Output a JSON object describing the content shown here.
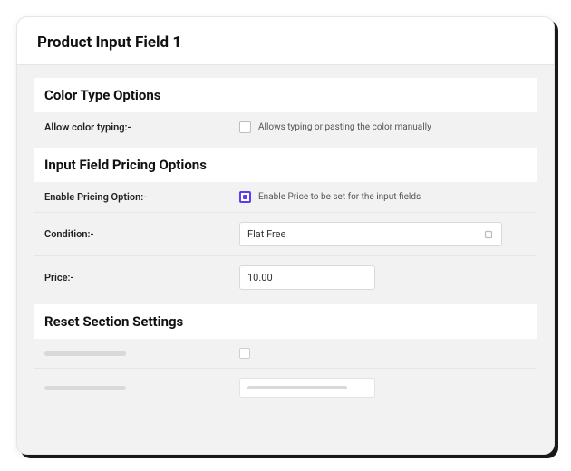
{
  "page": {
    "title": "Product Input Field 1"
  },
  "color_section": {
    "title": "Color Type Options",
    "allow_typing_label": "Allow color typing:-",
    "allow_typing_checked": false,
    "allow_typing_desc": "Allows typing or pasting the color manually"
  },
  "pricing_section": {
    "title": "Input Field Pricing Options",
    "enable_label": "Enable Pricing Option:-",
    "enable_checked": true,
    "enable_desc": "Enable Price to be set for the input fields",
    "condition_label": "Condition:-",
    "condition_value": "Flat Free",
    "price_label": "Price:-",
    "price_value": "10.00"
  },
  "reset_section": {
    "title": "Reset Section Settings"
  },
  "colors": {
    "accent": "#5b3df5"
  }
}
